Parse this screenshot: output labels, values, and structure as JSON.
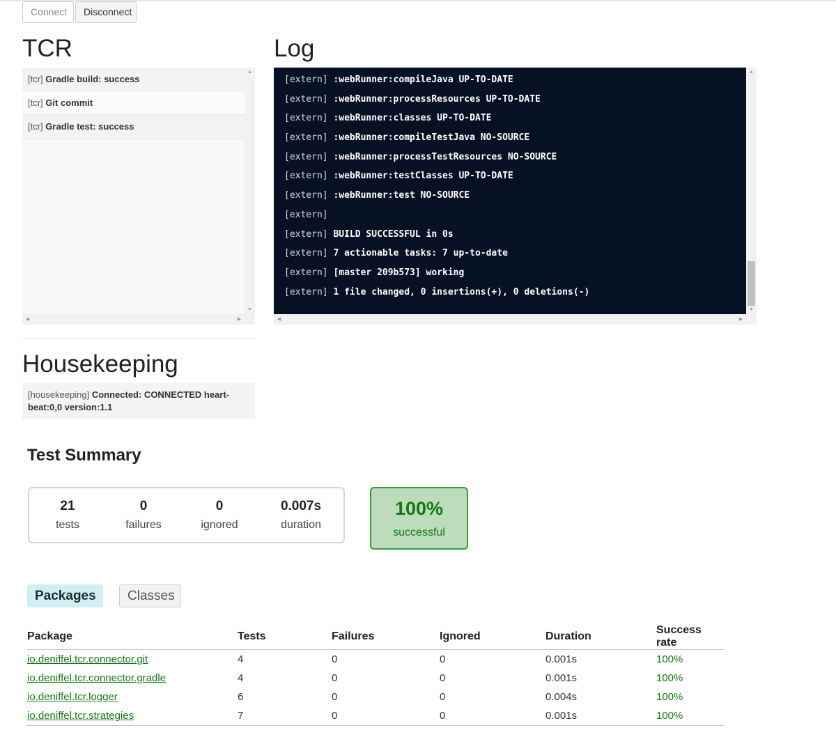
{
  "toolbar": {
    "connect_label": "Connect",
    "disconnect_label": "Disconnect"
  },
  "tcr": {
    "title": "TCR",
    "items": [
      {
        "prefix": "[tcr]",
        "message": "Gradle build: success"
      },
      {
        "prefix": "[tcr]",
        "message": "Git commit"
      },
      {
        "prefix": "[tcr]",
        "message": "Gradle test: success"
      }
    ]
  },
  "log": {
    "title": "Log",
    "lines": [
      {
        "prefix": "[extern]",
        "message": ":webRunner:compileJava UP-TO-DATE"
      },
      {
        "prefix": "[extern]",
        "message": ":webRunner:processResources UP-TO-DATE"
      },
      {
        "prefix": "[extern]",
        "message": ":webRunner:classes UP-TO-DATE"
      },
      {
        "prefix": "[extern]",
        "message": ":webRunner:compileTestJava NO-SOURCE"
      },
      {
        "prefix": "[extern]",
        "message": ":webRunner:processTestResources NO-SOURCE"
      },
      {
        "prefix": "[extern]",
        "message": ":webRunner:testClasses UP-TO-DATE"
      },
      {
        "prefix": "[extern]",
        "message": ":webRunner:test NO-SOURCE"
      },
      {
        "prefix": "[extern]",
        "message": ""
      },
      {
        "prefix": "[extern]",
        "message": "BUILD SUCCESSFUL in 0s"
      },
      {
        "prefix": "[extern]",
        "message": "7 actionable tasks: 7 up-to-date"
      },
      {
        "prefix": "[extern]",
        "message": "[master 209b573] working"
      },
      {
        "prefix": "[extern]",
        "message": "1 file changed, 0 insertions(+), 0 deletions(-)"
      }
    ]
  },
  "housekeeping": {
    "title": "Housekeeping",
    "prefix": "[housekeeping]",
    "message": "Connected: CONNECTED heart-beat:0,0 version:1.1"
  },
  "summary": {
    "title": "Test Summary",
    "tests_value": "21",
    "tests_label": "tests",
    "failures_value": "0",
    "failures_label": "failures",
    "ignored_value": "0",
    "ignored_label": "ignored",
    "duration_value": "0.007s",
    "duration_label": "duration",
    "success_value": "100%",
    "success_label": "successful",
    "success_color": "#127a12"
  },
  "tabs": {
    "packages_label": "Packages",
    "classes_label": "Classes"
  },
  "packages_table": {
    "headers": [
      "Package",
      "Tests",
      "Failures",
      "Ignored",
      "Duration",
      "Success rate"
    ],
    "rows": [
      {
        "package": "io.deniffel.tcr.connector.git",
        "tests": "4",
        "failures": "0",
        "ignored": "0",
        "duration": "0.001s",
        "rate": "100%"
      },
      {
        "package": "io.deniffel.tcr.connector.gradle",
        "tests": "4",
        "failures": "0",
        "ignored": "0",
        "duration": "0.001s",
        "rate": "100%"
      },
      {
        "package": "io.deniffel.tcr.logger",
        "tests": "6",
        "failures": "0",
        "ignored": "0",
        "duration": "0.004s",
        "rate": "100%"
      },
      {
        "package": "io.deniffel.tcr.strategies",
        "tests": "7",
        "failures": "0",
        "ignored": "0",
        "duration": "0.001s",
        "rate": "100%"
      }
    ]
  }
}
